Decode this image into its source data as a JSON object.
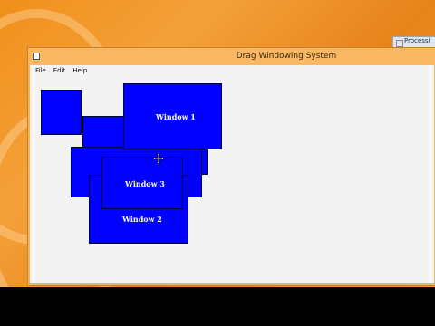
{
  "app": {
    "title": "Drag Windowing System",
    "menu": [
      {
        "label": "File"
      },
      {
        "label": "Edit"
      },
      {
        "label": "Help"
      }
    ]
  },
  "background_window": {
    "label": "Processi"
  },
  "windows": [
    {
      "label": ""
    },
    {
      "label": "Window 1"
    },
    {
      "label": ""
    },
    {
      "label": ""
    },
    {
      "label": "Window 3"
    },
    {
      "label": "Window 2"
    }
  ],
  "colors": {
    "window_blue": "#0000ff",
    "desktop_orange": "#f08f1a",
    "title_bar": "#f8b762",
    "client_bg": "#f3f3f3"
  },
  "cursor": {
    "icon": "move-cursor-icon"
  }
}
